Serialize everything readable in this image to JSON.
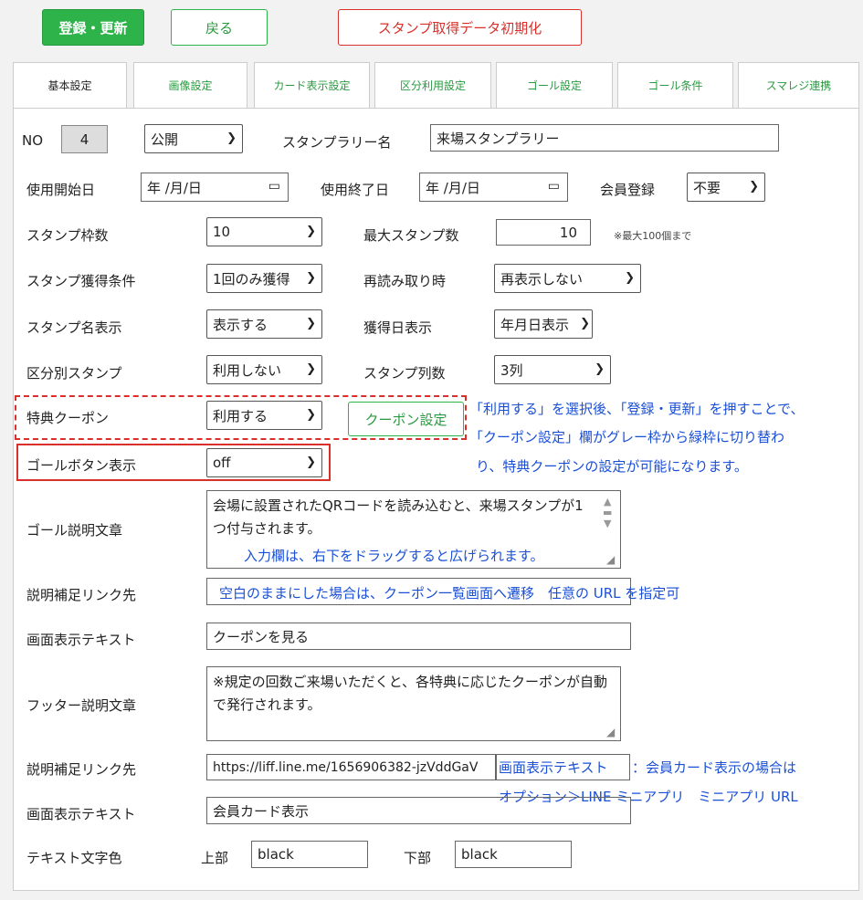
{
  "toolbar": {
    "register_label": "登録・更新",
    "back_label": "戻る",
    "reset_label": "スタンプ取得データ初期化"
  },
  "tabs": [
    {
      "label": "基本設定"
    },
    {
      "label": "画像設定"
    },
    {
      "label": "カード表示設定"
    },
    {
      "label": "区分利用設定"
    },
    {
      "label": "ゴール設定"
    },
    {
      "label": "ゴール条件"
    },
    {
      "label": "スマレジ連携"
    }
  ],
  "form": {
    "no_label": "NO",
    "no_value": "4",
    "visibility_value": "公開",
    "rally_name_label": "スタンプラリー名",
    "rally_name_value": "来場スタンプラリー",
    "start_date_label": "使用開始日",
    "start_date_value": "年 /月/日",
    "end_date_label": "使用終了日",
    "end_date_value": "年 /月/日",
    "member_reg_label": "会員登録",
    "member_reg_value": "不要",
    "frame_count_label": "スタンプ枠数",
    "frame_count_value": "10",
    "max_stamps_label": "最大スタンプ数",
    "max_stamps_value": "10",
    "max_stamps_note": "※最大100個まで",
    "acquire_cond_label": "スタンプ獲得条件",
    "acquire_cond_value": "1回のみ獲得",
    "reread_label": "再読み取り時",
    "reread_value": "再表示しない",
    "name_display_label": "スタンプ名表示",
    "name_display_value": "表示する",
    "date_display_label": "獲得日表示",
    "date_display_value": "年月日表示",
    "category_label": "区分別スタンプ",
    "category_value": "利用しない",
    "columns_label": "スタンプ列数",
    "columns_value": "3列",
    "coupon_label": "特典クーポン",
    "coupon_value": "利用する",
    "coupon_button": "クーポン設定",
    "goal_button_label": "ゴールボタン表示",
    "goal_button_value": "off",
    "goal_desc_label": "ゴール説明文章",
    "goal_desc_value": "会場に設置されたQRコードを読み込むと、来場スタンプが1つ付与されます。",
    "link1_label": "説明補足リンク先",
    "link1_value": "",
    "screen_text1_label": "画面表示テキスト",
    "screen_text1_value": "クーポンを見る",
    "footer_label": "フッター説明文章",
    "footer_value": "※規定の回数ご来場いただくと、各特典に応じたクーポンが自動で発行されます。",
    "link2_label": "説明補足リンク先",
    "link2_value": "https://liff.line.me/1656906382-jzVddGaV",
    "screen_text2_label": "画面表示テキスト",
    "screen_text2_value": "会員カード表示",
    "text_color_label": "テキスト文字色",
    "top_label": "上部",
    "top_value": "black",
    "bottom_label": "下部",
    "bottom_value": "black"
  },
  "annotations": {
    "coupon_note": "「利用する」を選択後、「登録・更新」を押すことで、「クーポン設定」欄がグレー枠から緑枠に切り替わり、特典クーポンの設定が可能になります。",
    "coupon_note_l1": "「利用する」を選択後、「登録・更新」を押すことで、",
    "coupon_note_l2": "「クーポン設定」欄がグレー枠から緑枠に切り替わ",
    "coupon_note_l3": "り、特典クーポンの設定が可能になります。",
    "resize_note": "入力欄は、右下をドラッグすると広げられます。",
    "link_note": "空白のままにした場合は、クーポン一覧画面へ遷移　任意の URL を指定可",
    "screen_note_l1": "画面表示テキスト",
    "screen_note_l1b": "：会員カード表示の場合は",
    "screen_note_l2": "オプション＞LINE ミニアプリ　ミニアプリ URL"
  },
  "colors": {
    "accent_green": "#2db34a",
    "danger_red": "#d9302c",
    "note_blue": "#1a4fd6"
  }
}
